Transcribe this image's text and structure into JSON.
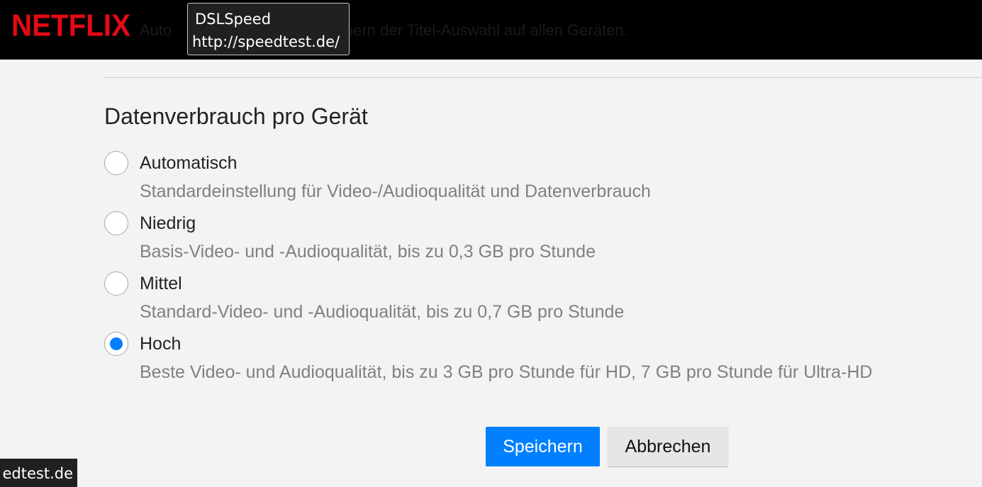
{
  "header": {
    "logo_text": "NETFLIX",
    "partial_text_left": "Auto",
    "partial_text_right": "eim Durchstöbern der Titel-Auswahl auf allen Geräten."
  },
  "tooltip": {
    "title": "DSLSpeed",
    "url": "http://speedtest.de/"
  },
  "section": {
    "title": "Datenverbrauch pro Gerät",
    "options": [
      {
        "label": "Automatisch",
        "description": "Standardeinstellung für Video-/Audioqualität und Datenverbrauch",
        "selected": false
      },
      {
        "label": "Niedrig",
        "description": "Basis-Video- und -Audioqualität, bis zu 0,3 GB pro Stunde",
        "selected": false
      },
      {
        "label": "Mittel",
        "description": "Standard-Video- und -Audioqualität, bis zu 0,7 GB pro Stunde",
        "selected": false
      },
      {
        "label": "Hoch",
        "description": "Beste Video- und Audioqualität, bis zu 3 GB pro Stunde für HD, 7 GB pro Stunde für Ultra-HD",
        "selected": true
      }
    ]
  },
  "buttons": {
    "save_label": "Speichern",
    "cancel_label": "Abbrechen"
  },
  "status_bar": {
    "url_fragment": "edtest.de"
  },
  "colors": {
    "brand_red": "#e50914",
    "accent_blue": "#0080ff",
    "background": "#f3f3f3"
  }
}
